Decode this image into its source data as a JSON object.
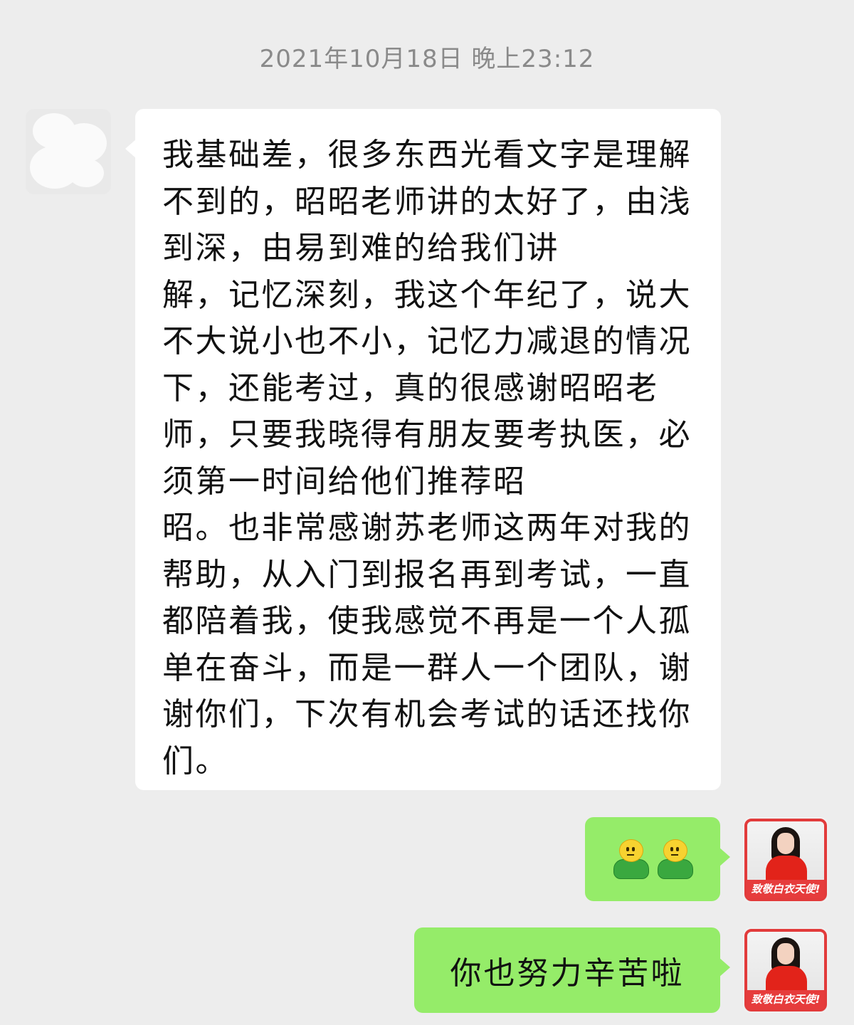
{
  "chat": {
    "timestamp": "2021年10月18日 晚上23:12",
    "messages": [
      {
        "direction": "incoming",
        "text": "我基础差，很多东西光看文字是理解不到的，昭昭老师讲的太好了，由浅到深，由易到难的给我们讲\n解，记忆深刻，我这个年纪了，说大不大说小也不小，记忆力减退的情况下，还能考过，真的很感谢昭昭老师，只要我晓得有朋友要考执医，必须第一时间给他们推荐昭\n昭。也非常感谢苏老师这两年对我的帮助，从入门到报名再到考试，一直都陪着我，使我感觉不再是一个人孤单在奋斗，而是一群人一个团队，谢谢你们，下次有机会考试的话还找你们。"
      },
      {
        "direction": "outgoing",
        "emojis": [
          "doge-green-icon",
          "doge-green-icon"
        ]
      },
      {
        "direction": "outgoing",
        "text": "你也努力辛苦啦"
      }
    ],
    "self_avatar_caption": "致敬白衣天使!"
  },
  "colors": {
    "background": "#ededed",
    "incoming_bubble": "#ffffff",
    "outgoing_bubble": "#95ec69",
    "timestamp_text": "#8a8a8a"
  }
}
